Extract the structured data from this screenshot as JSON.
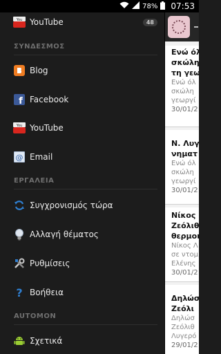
{
  "status": {
    "battery": "78%",
    "time": "07:53"
  },
  "drawer": {
    "top_item": {
      "label": "YouTube",
      "badge": "48"
    },
    "sections": [
      {
        "title": "ΣΥΝΔΕΣΜΟΣ"
      },
      {
        "title": "ΕΡΓΑΛΕΙΑ"
      },
      {
        "title": "AUTOMON"
      }
    ],
    "links": [
      {
        "label": "Blog",
        "icon": "blogger-icon"
      },
      {
        "label": "Facebook",
        "icon": "facebook-icon"
      },
      {
        "label": "YouTube",
        "icon": "youtube-icon"
      },
      {
        "label": "Email",
        "icon": "email-icon"
      }
    ],
    "tools": [
      {
        "label": "Συγχρονισμός τώρα",
        "icon": "sync-icon"
      },
      {
        "label": "Αλλαγή θέματος",
        "icon": "bulb-icon"
      },
      {
        "label": "Ρυθμίσεις",
        "icon": "tools-icon"
      },
      {
        "label": "Βοήθεια",
        "icon": "help-icon"
      }
    ],
    "about": {
      "label": "Σχετικά",
      "icon": "android-icon"
    }
  },
  "feed": [
    {
      "lines": [
        "Ενώ όλ",
        "σκώλη",
        "τη γεω"
      ],
      "snippet": [
        "Ενώ όλ",
        "σκώλη",
        "γεωργί"
      ],
      "date": "30/01/2"
    },
    {
      "lines": [
        "Ν. Λυγ",
        "νηματ"
      ],
      "snippet": [
        "Ενώ όλ",
        "σκώλη",
        "γεωργί"
      ],
      "date": "30/01/2"
    },
    {
      "lines": [
        "Νίκος",
        "Ζεόλιθ",
        "θερμοι"
      ],
      "snippet": [
        "Νίκος Λ",
        "σε ντομ",
        "Ελένης"
      ],
      "date": "30/01/2"
    },
    {
      "lines": [
        "Δηλώσ",
        "Ζεόλι"
      ],
      "snippet": [
        "Δηλώσ",
        "Ζεόλιθ",
        "Λυγερό"
      ],
      "date": "29/01/2"
    }
  ],
  "colors": {
    "drawer_bg": "#1c1c1c",
    "accent_blue": "#2f7fd1",
    "youtube_red": "#d8261e"
  }
}
